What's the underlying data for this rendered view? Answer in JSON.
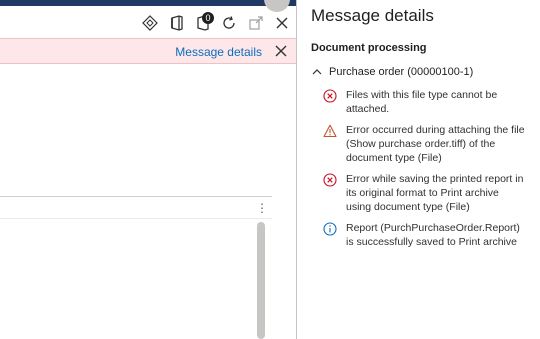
{
  "toolbar": {
    "icons": [
      "diamond-icon",
      "office-icon",
      "notifications-icon",
      "refresh-icon",
      "open-in-new-icon",
      "close-icon"
    ],
    "notification_count": "0"
  },
  "message_bar": {
    "link_label": "Message details"
  },
  "pane": {
    "title": "Message details",
    "section_title": "Document processing",
    "group_label": "Purchase order (00000100-1)",
    "messages": [
      {
        "type": "error",
        "text": "Files with this file type cannot be attached."
      },
      {
        "type": "warning",
        "text": "Error occurred during attaching the file (Show purchase order.tiff) of the document type (File)"
      },
      {
        "type": "error",
        "text": "Error while saving the printed report in its original format to Print archive using document type (File)"
      },
      {
        "type": "info",
        "text": "Report (PurchPurchaseOrder.Report) is successfully saved to Print archive"
      }
    ]
  },
  "colors": {
    "error": "#c50f1f",
    "warning": "#c4542a",
    "info": "#0f6cbd",
    "message_bar_bg": "#fde7e9",
    "link": "#0f6cbd"
  }
}
